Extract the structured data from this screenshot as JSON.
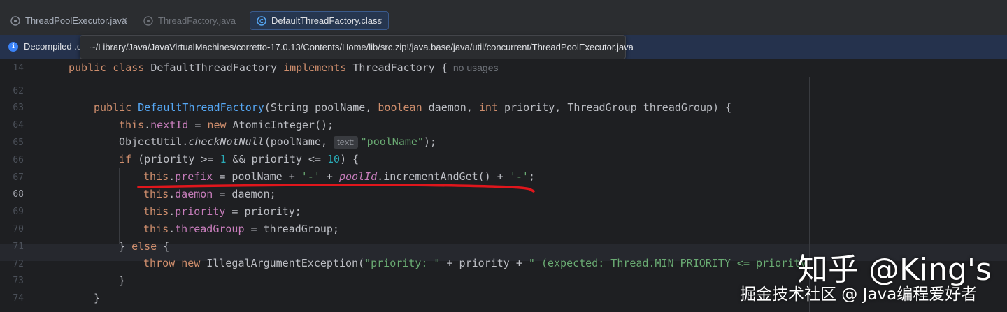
{
  "tabs": [
    {
      "label": "ThreadPoolExecutor.java",
      "close": "×",
      "icon": "java-file-icon"
    },
    {
      "label": "ThreadFactory.java",
      "close": "",
      "icon": "java-file-icon"
    },
    {
      "label": "DefaultThreadFactory.class",
      "close": "×",
      "icon": "class-file-icon",
      "active": true
    }
  ],
  "banner": {
    "text": "Decompiled .c",
    "icon": "info-icon"
  },
  "tooltip": {
    "path": "~/Library/Java/JavaVirtualMachines/corretto-17.0.13/Contents/Home/lib/src.zip!/java.base/java/util/concurrent/ThreadPoolExecutor.java"
  },
  "line_numbers": [
    "14",
    "62",
    "63",
    "64",
    "65",
    "66",
    "67",
    "68",
    "69",
    "70",
    "71",
    "72",
    "73",
    "74"
  ],
  "code": {
    "l14": {
      "kw1": "public",
      "kw2": "class",
      "name": "DefaultThreadFactory",
      "kw3": "implements",
      "iface": "ThreadFactory {",
      "usage": "no usages"
    },
    "l63": {
      "kw": "public",
      "ctor": "DefaultThreadFactory",
      "params1": "(String poolName, ",
      "kw2": "boolean",
      "params2": " daemon, ",
      "kw3": "int",
      "params3": " priority, ThreadGroup threadGroup) {"
    },
    "l64": {
      "this": "this",
      "dot": ".",
      "fld": "nextId",
      "rest1": " = ",
      "kw": "new",
      "rest2": " AtomicInteger();"
    },
    "l65": {
      "pre": "ObjectUtil.",
      "method": "checkNotNull",
      "mid": "(poolName, ",
      "hint": "text:",
      "str": "\"poolName\"",
      "end": ");"
    },
    "l66": {
      "kw": "if",
      "a": " (priority >= ",
      "n1": "1",
      "b": " && priority <= ",
      "n2": "10",
      "c": ") {"
    },
    "l67": {
      "this": "this",
      "dot": ".",
      "fld": "prefix",
      "a": " = poolName + ",
      "s1": "'-'",
      "b": " + ",
      "sfld": "poolId",
      "c": ".incrementAndGet() + ",
      "s2": "'-'",
      "d": ";"
    },
    "l68": {
      "this": "this",
      "dot": ".",
      "fld": "daemon",
      "a": " = daemon;"
    },
    "l69": {
      "this": "this",
      "dot": ".",
      "fld": "priority",
      "a": " = priority;"
    },
    "l70": {
      "this": "this",
      "dot": ".",
      "fld": "threadGroup",
      "a": " = threadGroup;"
    },
    "l71": {
      "a": "} ",
      "kw": "else",
      "b": " {"
    },
    "l72": {
      "kw1": "throw",
      "sp": " ",
      "kw2": "new",
      "a": " IllegalArgumentException(",
      "s1": "\"priority: \"",
      "b": " + priority + ",
      "s2": "\" (expected: Thread.MIN_PRIORITY <= priority"
    },
    "l73": {
      "a": "}"
    },
    "l74": {
      "a": "}"
    }
  },
  "watermark": {
    "line1": "知乎 @King's",
    "line2": "掘金技术社区 @ Java编程爱好者"
  },
  "colors": {
    "keyword": "#cf8e6d",
    "field": "#c77dbb",
    "string": "#6aab73",
    "number": "#2aacb8",
    "function": "#56a8f5",
    "annotation_underline": "#e0161c"
  }
}
